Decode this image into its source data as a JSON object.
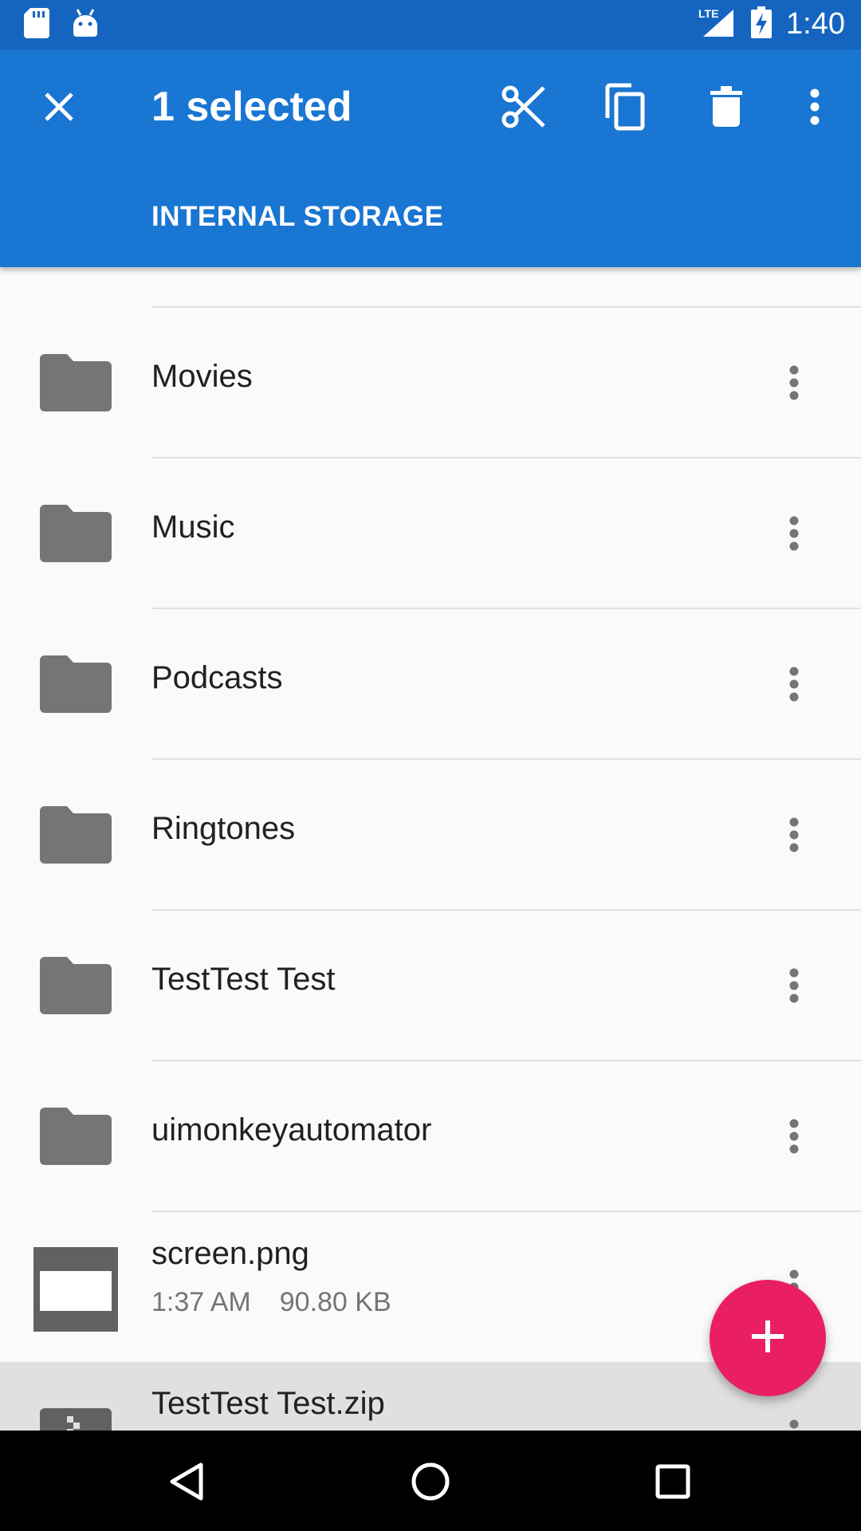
{
  "status_bar": {
    "time": "1:40",
    "network": "LTE",
    "icons": [
      "sd-card-icon",
      "android-icon",
      "signal-icon",
      "battery-charging-icon"
    ]
  },
  "action_bar": {
    "title": "1 selected",
    "breadcrumb": "INTERNAL STORAGE",
    "actions": [
      "close-icon",
      "cut-icon",
      "copy-icon",
      "delete-icon",
      "more-vert-icon"
    ],
    "background": "#1976d2",
    "status_background": "#1565c0"
  },
  "files": [
    {
      "name": "Movies",
      "type": "folder"
    },
    {
      "name": "Music",
      "type": "folder"
    },
    {
      "name": "Podcasts",
      "type": "folder"
    },
    {
      "name": "Ringtones",
      "type": "folder"
    },
    {
      "name": "TestTest Test",
      "type": "folder"
    },
    {
      "name": "uimonkeyautomator",
      "type": "folder"
    },
    {
      "name": "screen.png",
      "type": "image",
      "modified": "1:37 AM",
      "size": "90.80 KB"
    },
    {
      "name": "TestTest Test.zip",
      "type": "archive",
      "selected": true
    }
  ],
  "fab": {
    "icon": "add-icon",
    "color": "#e91e63"
  },
  "nav": {
    "icons": [
      "back-icon",
      "home-icon",
      "recents-icon"
    ]
  }
}
